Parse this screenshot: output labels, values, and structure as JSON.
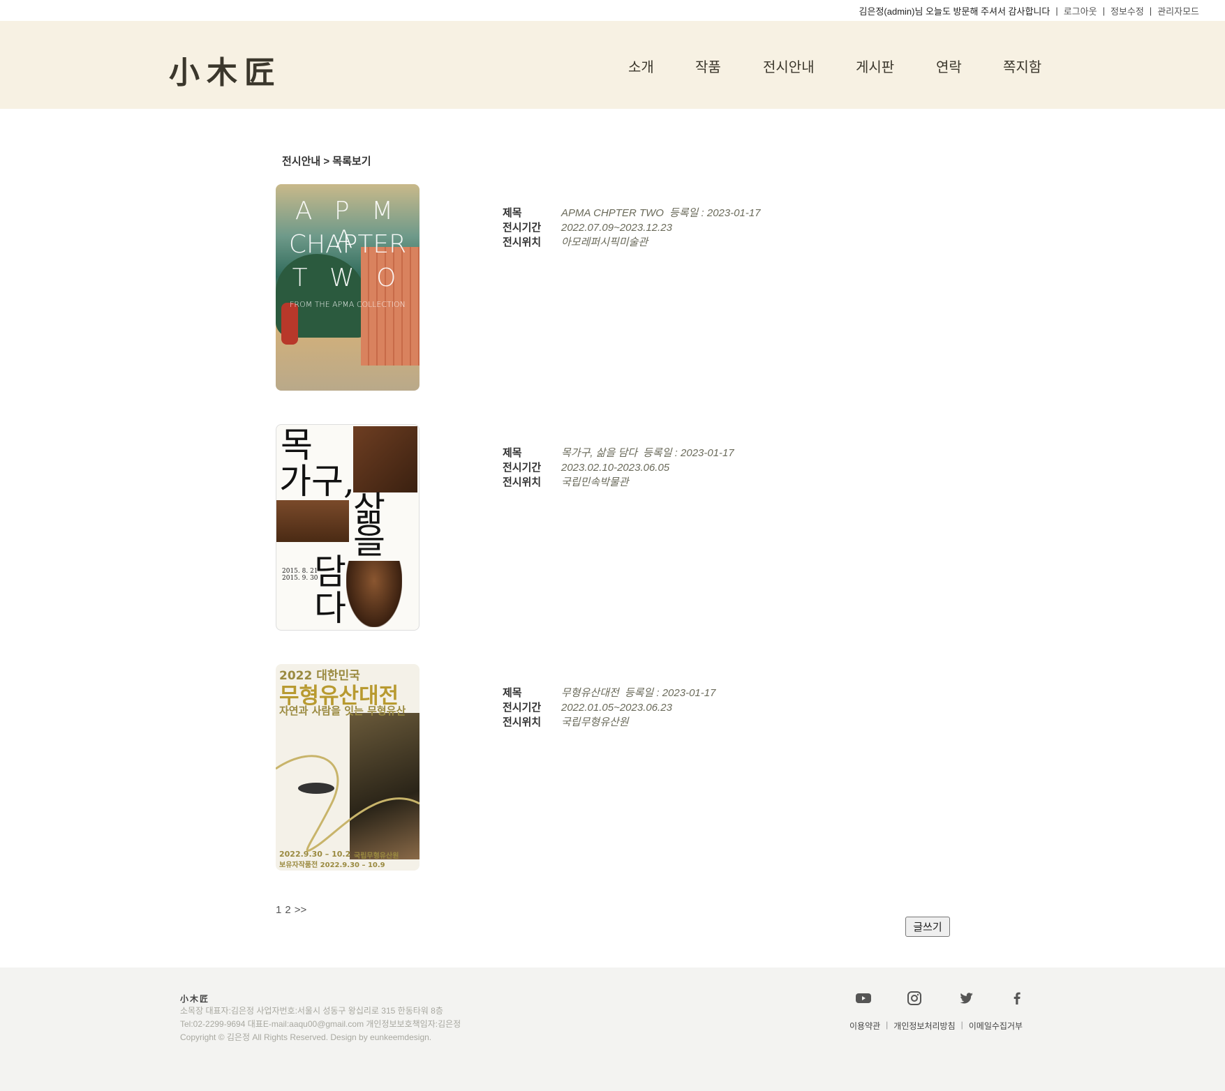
{
  "util": {
    "greeting": "김은정(admin)님 오늘도 방문해 주셔서 감사합니다",
    "logout": "로그아웃",
    "edit_info": "정보수정",
    "admin_mode": "관리자모드",
    "sep": "|"
  },
  "header": {
    "logo": "小木匠",
    "nav": [
      "소개",
      "작품",
      "전시안내",
      "게시판",
      "연락",
      "쪽지함"
    ]
  },
  "breadcrumb": "전시안내 > 목록보기",
  "labels": {
    "title": "제목",
    "period": "전시기간",
    "location": "전시위치"
  },
  "exhibitions": [
    {
      "title": "APMA CHPTER TWO",
      "registered": "등록일 : 2023-01-17",
      "period": "2022.07.09~2023.12.23",
      "location": "아모레퍼시픽미술관",
      "poster": {
        "line1": "A P M A",
        "line2": "CHAPTER",
        "line3": "T W O",
        "line4": "FROM THE APMA COLLECTION"
      }
    },
    {
      "title": "목가구, 삶을 담다",
      "registered": "등록일 : 2023-01-17",
      "period": "2023.02.10-2023.06.05",
      "location": "국립민속박물관",
      "poster": {
        "c1": "목",
        "c2": "가구,",
        "c3": "삶",
        "c4": "을",
        "c5": "담",
        "c6": "다",
        "dates": "2015. 8. 21 –\n2015. 9. 30"
      }
    },
    {
      "title": "무형유산대전",
      "registered": "등록일 : 2023-01-17",
      "period": "2022.01.05~2023.06.23",
      "location": "국립무형유산원",
      "poster": {
        "line1": "2022 대한민국",
        "line2": "무형유산대전",
        "line3": "자연과 사람을 잇는 무형유산",
        "line4": "2022.9.30 – 10.2",
        "line5": "국립무형유산원",
        "line6": "보유자작품전 2022.9.30 – 10.9"
      }
    }
  ],
  "pagination": {
    "pages": [
      "1",
      "2"
    ],
    "next": ">>"
  },
  "write_button": "글쓰기",
  "footer": {
    "logo": "小木匠",
    "line1": "소목장    대표자:김은정    사업자번호:서울시 성동구 왕십리로 315 한동타워 8층",
    "line2": "Tel:02-2299-9694    대표E-mail:aaqu00@gmail.com    개인정보보호책임자:김은정",
    "line3": "Copyright © 김은정  All Rights Reserved.    Design by eunkeemdesign.",
    "social_icons": [
      "youtube-icon",
      "instagram-icon",
      "twitter-icon",
      "facebook-icon"
    ],
    "links": [
      "이용약관",
      "개인정보처리방침",
      "이메일수집거부"
    ]
  }
}
